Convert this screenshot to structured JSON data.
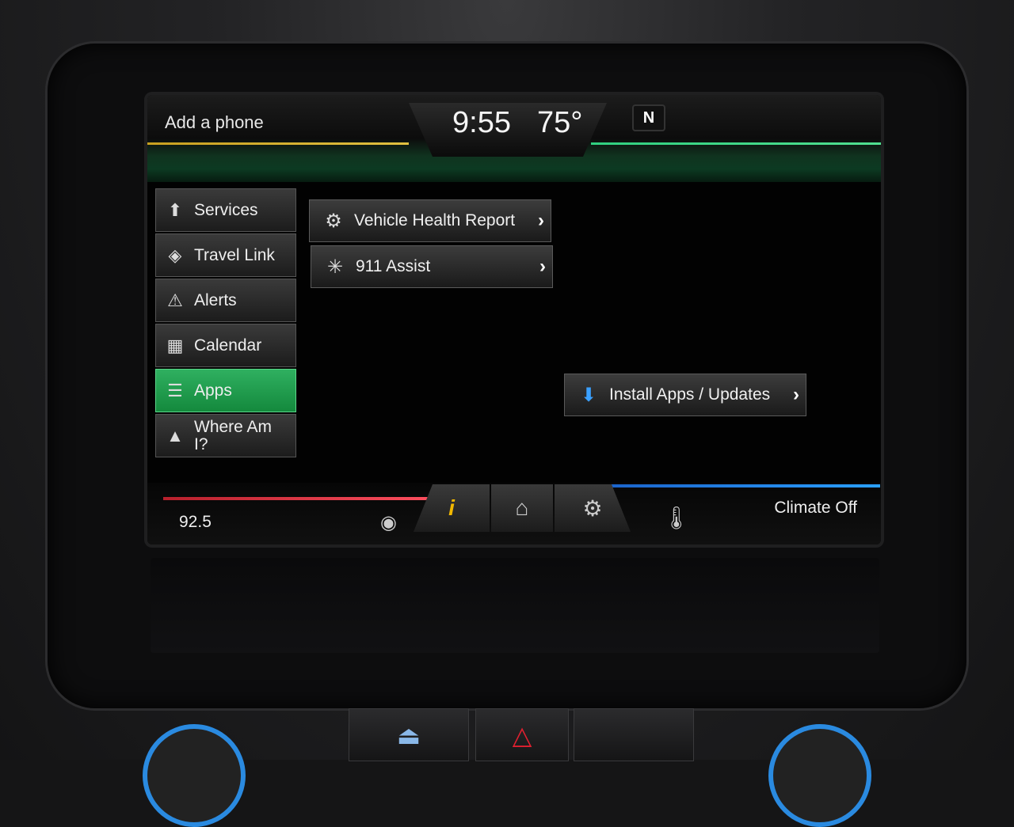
{
  "status": {
    "phone_label": "Add a phone",
    "time": "9:55",
    "temperature": "75°",
    "compass": "N"
  },
  "side_menu": [
    {
      "label": "Services",
      "icon": "services-icon",
      "active": false
    },
    {
      "label": "Travel Link",
      "icon": "travel-link-icon",
      "active": false
    },
    {
      "label": "Alerts",
      "icon": "warning-icon",
      "active": false
    },
    {
      "label": "Calendar",
      "icon": "calendar-icon",
      "active": false
    },
    {
      "label": "Apps",
      "icon": "apps-list-icon",
      "active": true
    },
    {
      "label": "Where Am I?",
      "icon": "location-arrow-icon",
      "active": false
    }
  ],
  "apps": {
    "vehicle_health": "Vehicle Health Report",
    "assist": "911 Assist",
    "install": "Install Apps / Updates"
  },
  "bottom": {
    "radio_frequency": "92.5",
    "climate": "Climate Off"
  },
  "colors": {
    "active_green": "#1f9e4c",
    "info_yellow": "#f2b800",
    "hazard_red": "#e02030",
    "climate_blue": "#2a8ae0"
  }
}
